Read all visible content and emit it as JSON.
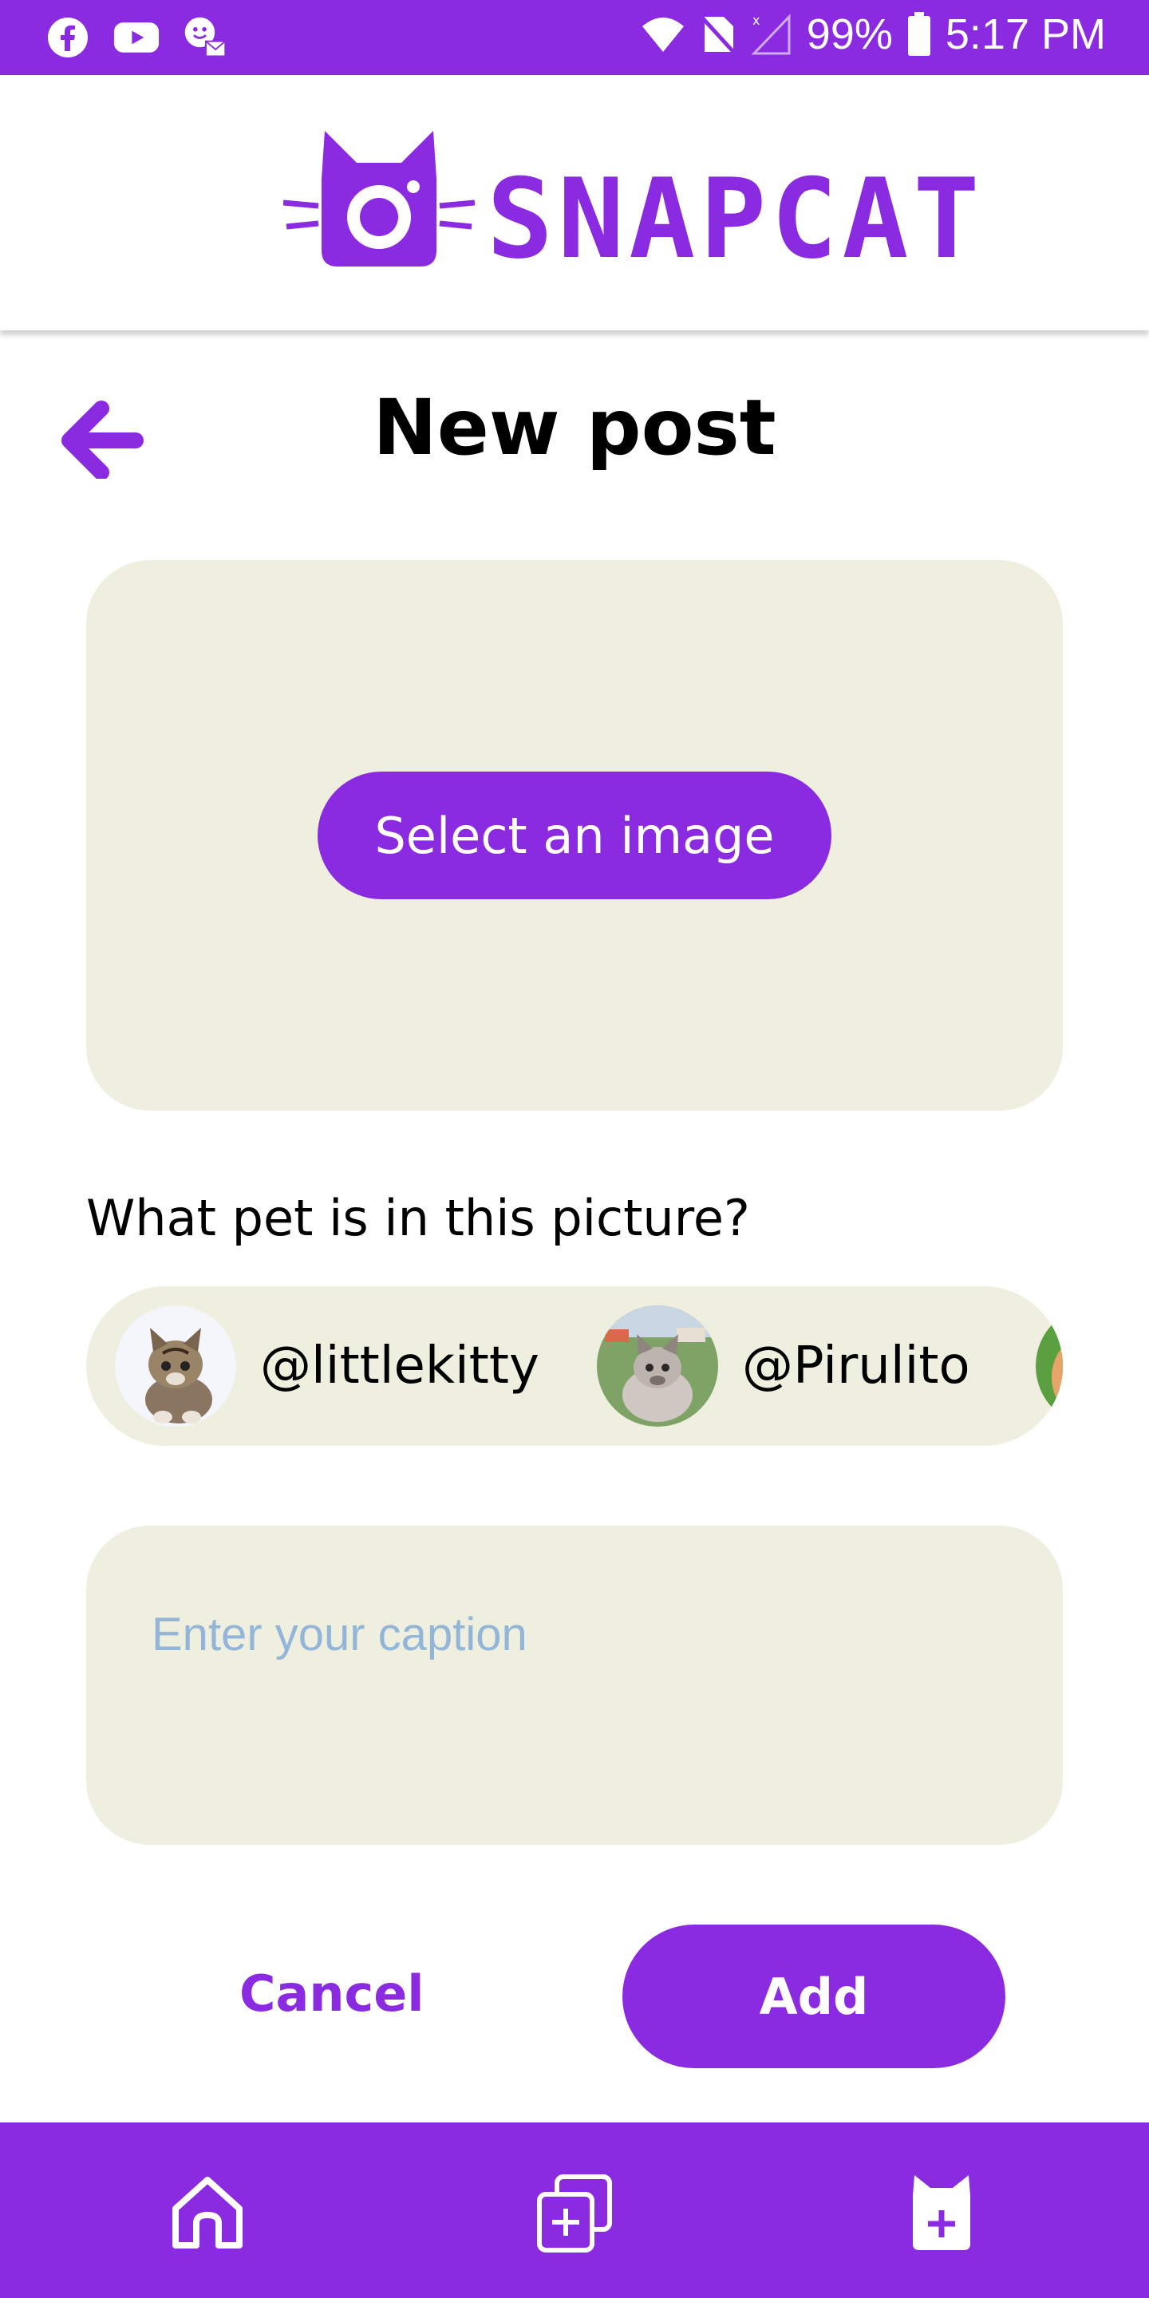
{
  "status_bar": {
    "battery": "99%",
    "time": "5:17 PM"
  },
  "app": {
    "logo_text": "SNAPCAT"
  },
  "page": {
    "title": "New post"
  },
  "image_picker": {
    "button_label": "Select an image"
  },
  "pet_selector": {
    "question": "What pet is in this picture?",
    "pets": [
      {
        "handle": "@littlekitty"
      },
      {
        "handle": "@Pirulito"
      }
    ]
  },
  "caption": {
    "placeholder": "Enter your caption",
    "value": ""
  },
  "actions": {
    "cancel_label": "Cancel",
    "add_label": "Add"
  },
  "colors": {
    "brand": "#8a2be2",
    "panel": "#eeefdf",
    "placeholder": "#93b6d8"
  }
}
